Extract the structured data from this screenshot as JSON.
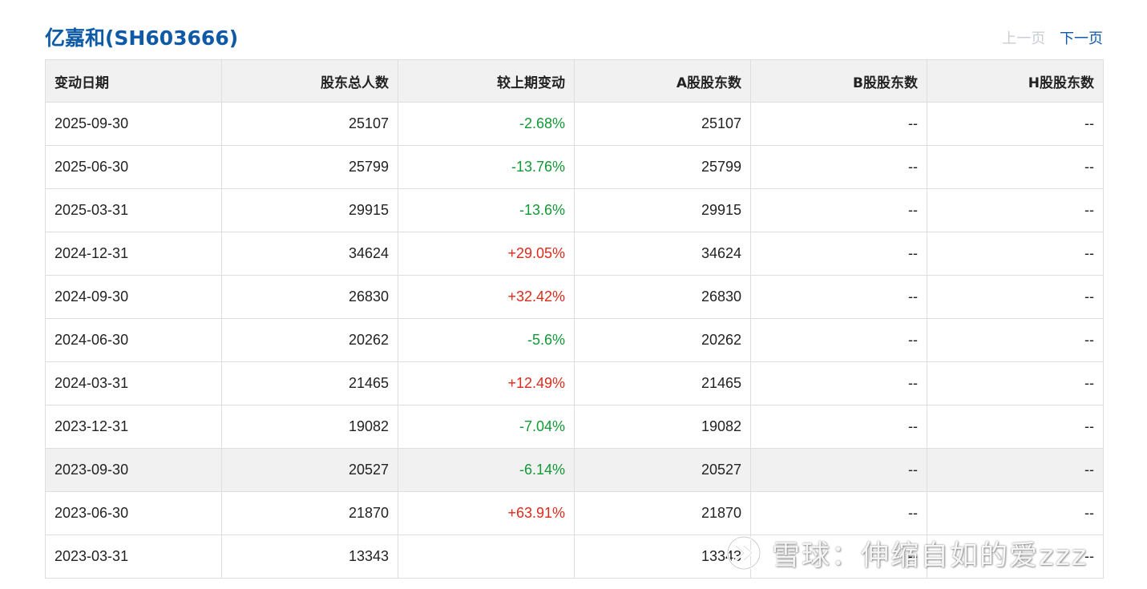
{
  "header": {
    "title": "亿嘉和(SH603666)",
    "prev_label": "上一页",
    "next_label": "下一页"
  },
  "table": {
    "columns": [
      "变动日期",
      "股东总人数",
      "较上期变动",
      "A股股东数",
      "B股股东数",
      "H股股东数"
    ],
    "rows": [
      {
        "date": "2025-09-30",
        "total": "25107",
        "change": "-2.68%",
        "change_dir": "neg",
        "a": "25107",
        "b": "--",
        "h": "--"
      },
      {
        "date": "2025-06-30",
        "total": "25799",
        "change": "-13.76%",
        "change_dir": "neg",
        "a": "25799",
        "b": "--",
        "h": "--"
      },
      {
        "date": "2025-03-31",
        "total": "29915",
        "change": "-13.6%",
        "change_dir": "neg",
        "a": "29915",
        "b": "--",
        "h": "--"
      },
      {
        "date": "2024-12-31",
        "total": "34624",
        "change": "+29.05%",
        "change_dir": "pos",
        "a": "34624",
        "b": "--",
        "h": "--"
      },
      {
        "date": "2024-09-30",
        "total": "26830",
        "change": "+32.42%",
        "change_dir": "pos",
        "a": "26830",
        "b": "--",
        "h": "--"
      },
      {
        "date": "2024-06-30",
        "total": "20262",
        "change": "-5.6%",
        "change_dir": "neg",
        "a": "20262",
        "b": "--",
        "h": "--"
      },
      {
        "date": "2024-03-31",
        "total": "21465",
        "change": "+12.49%",
        "change_dir": "pos",
        "a": "21465",
        "b": "--",
        "h": "--"
      },
      {
        "date": "2023-12-31",
        "total": "19082",
        "change": "-7.04%",
        "change_dir": "neg",
        "a": "19082",
        "b": "--",
        "h": "--"
      },
      {
        "date": "2023-09-30",
        "total": "20527",
        "change": "-6.14%",
        "change_dir": "neg",
        "a": "20527",
        "b": "--",
        "h": "--",
        "highlighted": true
      },
      {
        "date": "2023-06-30",
        "total": "21870",
        "change": "+63.91%",
        "change_dir": "pos",
        "a": "21870",
        "b": "--",
        "h": "--"
      },
      {
        "date": "2023-03-31",
        "total": "13343",
        "change": "",
        "change_dir": "",
        "a": "13343",
        "b": "--",
        "h": "--"
      }
    ]
  },
  "watermark": {
    "text": "雪球：伸缩自如的爱zzz",
    "icon": "xueqiu-logo-icon"
  },
  "colors": {
    "title": "#0e5aa7",
    "link": "#0e5aa7",
    "disabled": "#c8ced4",
    "negative": "#119936",
    "positive": "#dd2a1b",
    "header_bg": "#f1f1f1",
    "border": "#dedede"
  }
}
